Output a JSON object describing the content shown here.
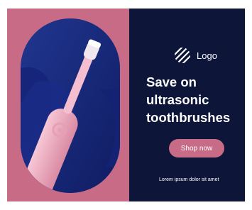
{
  "ad": {
    "logo": {
      "icon": "circular-stripes-logo-icon",
      "text": "Logo"
    },
    "headline": [
      "Save on",
      "ultrasonic",
      "toothbrushes"
    ],
    "cta_label": "Shop now",
    "disclaimer": "Lorem ipsum dolor sit amet",
    "colors": {
      "pink": "#c76b86",
      "navy": "#0d1638",
      "blue": "#1b2f8e",
      "brush": "#f2b3c6"
    }
  }
}
